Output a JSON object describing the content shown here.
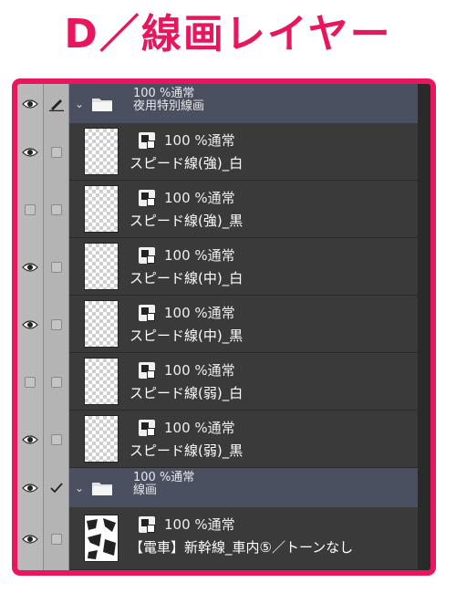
{
  "title": "D／線画レイヤー",
  "colors": {
    "accent": "#e8175d",
    "folder_bg": "#4a5060",
    "layer_bg": "#3a3a3a"
  },
  "folders": [
    {
      "mode": "100 %通常",
      "name": "夜用特別線画",
      "eye": true,
      "edit_icon": "pencil-icon"
    },
    {
      "mode": "100 %通常",
      "name": "線画",
      "eye": true,
      "edit_icon": "checkmark-icon"
    }
  ],
  "layers": [
    {
      "mode": "100 %通常",
      "name": "スピード線(強)_白",
      "eye": true,
      "thumb": "transparent"
    },
    {
      "mode": "100 %通常",
      "name": "スピード線(強)_黒",
      "eye": false,
      "thumb": "transparent"
    },
    {
      "mode": "100 %通常",
      "name": "スピード線(中)_白",
      "eye": true,
      "thumb": "transparent"
    },
    {
      "mode": "100 %通常",
      "name": "スピード線(中)_黒",
      "eye": true,
      "thumb": "transparent"
    },
    {
      "mode": "100 %通常",
      "name": "スピード線(弱)_白",
      "eye": false,
      "thumb": "transparent"
    },
    {
      "mode": "100 %通常",
      "name": "スピード線(弱)_黒",
      "eye": true,
      "thumb": "transparent"
    },
    {
      "mode": "100 %通常",
      "name": "【電車】新幹線_車内⑤／トーンなし",
      "eye": true,
      "thumb": "drawing"
    }
  ]
}
